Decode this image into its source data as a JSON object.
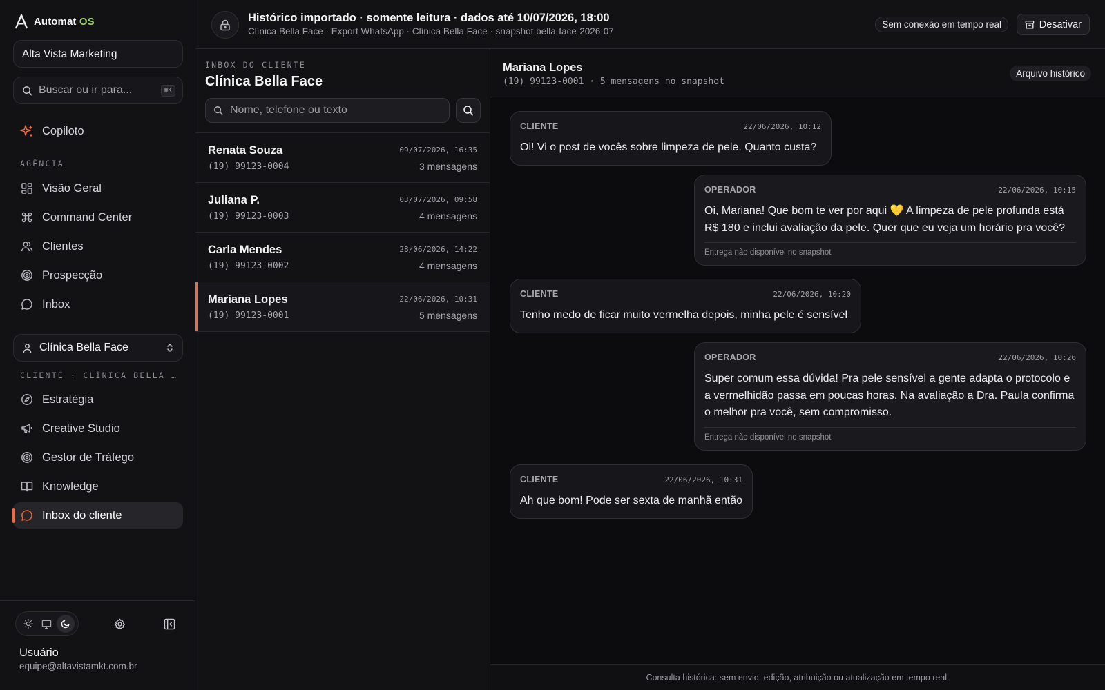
{
  "brand": {
    "name_prefix": "Automat",
    "name_suffix": "OS"
  },
  "sidebar": {
    "agency": "Alta Vista Marketing",
    "search_placeholder": "Buscar ou ir para...",
    "search_shortcut": "⌘K",
    "copilot": "Copiloto",
    "section_agency": "AGÊNCIA",
    "agency_items": [
      {
        "label": "Visão Geral",
        "icon": "grid-icon"
      },
      {
        "label": "Command Center",
        "icon": "command-icon"
      },
      {
        "label": "Clientes",
        "icon": "users-icon"
      },
      {
        "label": "Prospecção",
        "icon": "target-icon"
      },
      {
        "label": "Inbox",
        "icon": "chat-bubble-icon"
      }
    ],
    "client_selector": "Clínica Bella Face",
    "section_client": "CLIENTE · CLÍNICA BELLA …",
    "client_items": [
      {
        "label": "Estratégia",
        "icon": "compass-icon"
      },
      {
        "label": "Creative Studio",
        "icon": "megaphone-icon"
      },
      {
        "label": "Gestor de Tráfego",
        "icon": "target-icon"
      },
      {
        "label": "Knowledge",
        "icon": "book-icon"
      },
      {
        "label": "Inbox do cliente",
        "icon": "chat-bubble-icon"
      }
    ],
    "user": {
      "name": "Usuário",
      "email": "equipe@altavistamkt.com.br"
    }
  },
  "topbar": {
    "title": "Histórico importado · somente leitura · dados até 10/07/2026, 18:00",
    "subtitle": "Clínica Bella Face · Export WhatsApp · Clínica Bella Face · snapshot bella-face-2026-07",
    "connection_status": "Sem conexão em tempo real",
    "deactivate_label": "Desativar"
  },
  "inbox": {
    "eyebrow": "INBOX DO CLIENTE",
    "title": "Clínica Bella Face",
    "search_placeholder": "Nome, telefone ou texto",
    "conversations": [
      {
        "name": "Renata Souza",
        "phone": "(19) 99123-0004",
        "date": "09/07/2026, 16:35",
        "count": "3 mensagens"
      },
      {
        "name": "Juliana P.",
        "phone": "(19) 99123-0003",
        "date": "03/07/2026, 09:58",
        "count": "4 mensagens"
      },
      {
        "name": "Carla Mendes",
        "phone": "(19) 99123-0002",
        "date": "28/06/2026, 14:22",
        "count": "4 mensagens"
      },
      {
        "name": "Mariana Lopes",
        "phone": "(19) 99123-0001",
        "date": "22/06/2026, 10:31",
        "count": "5 mensagens"
      }
    ]
  },
  "chat": {
    "name": "Mariana Lopes",
    "subtitle": "(19) 99123-0001 · 5 mensagens no snapshot",
    "badge": "Arquivo histórico",
    "messages": [
      {
        "sender": "CLIENTE",
        "time": "22/06/2026, 10:12",
        "text": "Oi! Vi o post de vocês sobre limpeza de pele. Quanto custa?"
      },
      {
        "sender": "OPERADOR",
        "time": "22/06/2026, 10:15",
        "text": "Oi, Mariana! Que bom te ver por aqui 💛 A limpeza de pele profunda está R$ 180 e inclui avaliação da pele. Quer que eu veja um horário pra você?",
        "delivery": "Entrega não disponível no snapshot"
      },
      {
        "sender": "CLIENTE",
        "time": "22/06/2026, 10:20",
        "text": "Tenho medo de ficar muito vermelha depois, minha pele é sensível"
      },
      {
        "sender": "OPERADOR",
        "time": "22/06/2026, 10:26",
        "text": "Super comum essa dúvida! Pra pele sensível a gente adapta o protocolo e a vermelhidão passa em poucas horas. Na avaliação a Dra. Paula confirma o melhor pra você, sem compromisso.",
        "delivery": "Entrega não disponível no snapshot"
      },
      {
        "sender": "CLIENTE",
        "time": "22/06/2026, 10:31",
        "text": "Ah que bom! Pode ser sexta de manhã então"
      }
    ],
    "footer": "Consulta histórica: sem envio, edição, atribuição ou atualização em tempo real."
  },
  "colors": {
    "accent": "#ef6b3a",
    "logo_suffix": "#9bd36a",
    "background": "#0c0c0e"
  }
}
